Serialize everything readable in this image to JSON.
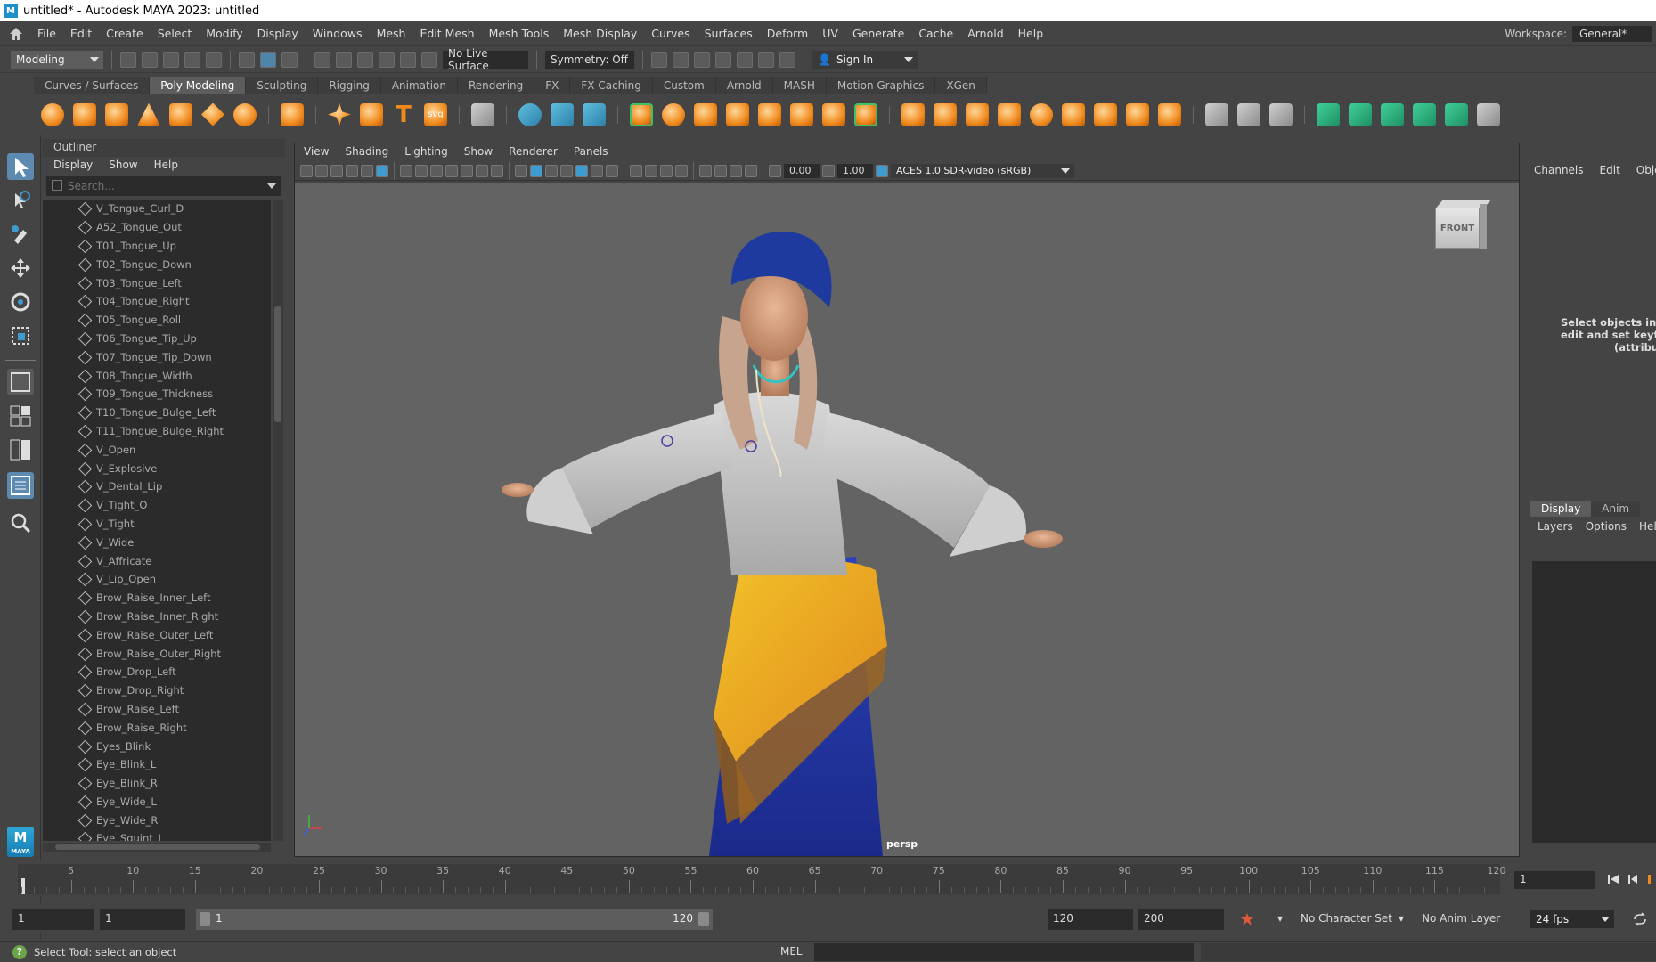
{
  "window": {
    "title": "untitled* - Autodesk MAYA 2023: untitled",
    "logo_letter": "M"
  },
  "menubar": {
    "items": [
      "File",
      "Edit",
      "Create",
      "Select",
      "Modify",
      "Display",
      "Windows",
      "Mesh",
      "Edit Mesh",
      "Mesh Tools",
      "Mesh Display",
      "Curves",
      "Surfaces",
      "Deform",
      "UV",
      "Generate",
      "Cache",
      "Arnold",
      "Help"
    ],
    "workspace_label": "Workspace:",
    "workspace_value": "General*"
  },
  "statusline": {
    "menu_set": "Modeling",
    "live_surface": "No Live Surface",
    "symmetry": "Symmetry: Off",
    "sign_in": "Sign In"
  },
  "shelf": {
    "tabs": [
      "Curves / Surfaces",
      "Poly Modeling",
      "Sculpting",
      "Rigging",
      "Animation",
      "Rendering",
      "FX",
      "FX Caching",
      "Custom",
      "Arnold",
      "MASH",
      "Motion Graphics",
      "XGen"
    ],
    "active_tab": "Poly Modeling",
    "text_tool_glyph": "T",
    "svg_tool_label": "svg"
  },
  "outliner": {
    "title": "Outliner",
    "menu": [
      "Display",
      "Show",
      "Help"
    ],
    "search_placeholder": "Search...",
    "items": [
      "V_Tongue_Curl_D",
      "A52_Tongue_Out",
      "T01_Tongue_Up",
      "T02_Tongue_Down",
      "T03_Tongue_Left",
      "T04_Tongue_Right",
      "T05_Tongue_Roll",
      "T06_Tongue_Tip_Up",
      "T07_Tongue_Tip_Down",
      "T08_Tongue_Width",
      "T09_Tongue_Thickness",
      "T10_Tongue_Bulge_Left",
      "T11_Tongue_Bulge_Right",
      "V_Open",
      "V_Explosive",
      "V_Dental_Lip",
      "V_Tight_O",
      "V_Tight",
      "V_Wide",
      "V_Affricate",
      "V_Lip_Open",
      "Brow_Raise_Inner_Left",
      "Brow_Raise_Inner_Right",
      "Brow_Raise_Outer_Left",
      "Brow_Raise_Outer_Right",
      "Brow_Drop_Left",
      "Brow_Drop_Right",
      "Brow_Raise_Left",
      "Brow_Raise_Right",
      "Eyes_Blink",
      "Eye_Blink_L",
      "Eye_Blink_R",
      "Eye_Wide_L",
      "Eye_Wide_R",
      "Eye_Squint_L"
    ]
  },
  "viewport": {
    "menu": [
      "View",
      "Shading",
      "Lighting",
      "Show",
      "Renderer",
      "Panels"
    ],
    "exposure": "0.00",
    "gamma": "1.00",
    "color_space": "ACES 1.0 SDR-video (sRGB)",
    "camera": "persp",
    "viewcube_face": "FRONT"
  },
  "channelbox": {
    "menu": [
      "Channels",
      "Edit",
      "Object"
    ],
    "message_lines": [
      "Select objects in the",
      "edit and set keyfran",
      "(attribu"
    ]
  },
  "layereditor": {
    "tabs": [
      "Display",
      "Anim"
    ],
    "active_tab": "Display",
    "menu": [
      "Layers",
      "Options",
      "Help"
    ]
  },
  "timeslider": {
    "ticks": [
      5,
      10,
      15,
      20,
      25,
      30,
      35,
      40,
      45,
      50,
      55,
      60,
      65,
      70,
      75,
      80,
      85,
      90,
      95,
      100,
      105,
      110,
      115,
      120
    ],
    "start_label": "1",
    "current_frame": "1",
    "min": 1,
    "max": 120
  },
  "rangeslider": {
    "start_time": "1",
    "playback_start": "1",
    "range_start": "1",
    "range_end": "120",
    "playback_end": "120",
    "end_time": "200",
    "character_set": "No Character Set",
    "anim_layer": "No Anim Layer",
    "fps": "24 fps"
  },
  "helpline": {
    "message": "Select Tool: select an object",
    "script_lang": "MEL"
  },
  "colors": {
    "accent": "#5d8ab0",
    "shelf_orange": "#f08a1d",
    "bg": "#444444",
    "field": "#2b2b2b",
    "viewport_bg": "#636363"
  }
}
